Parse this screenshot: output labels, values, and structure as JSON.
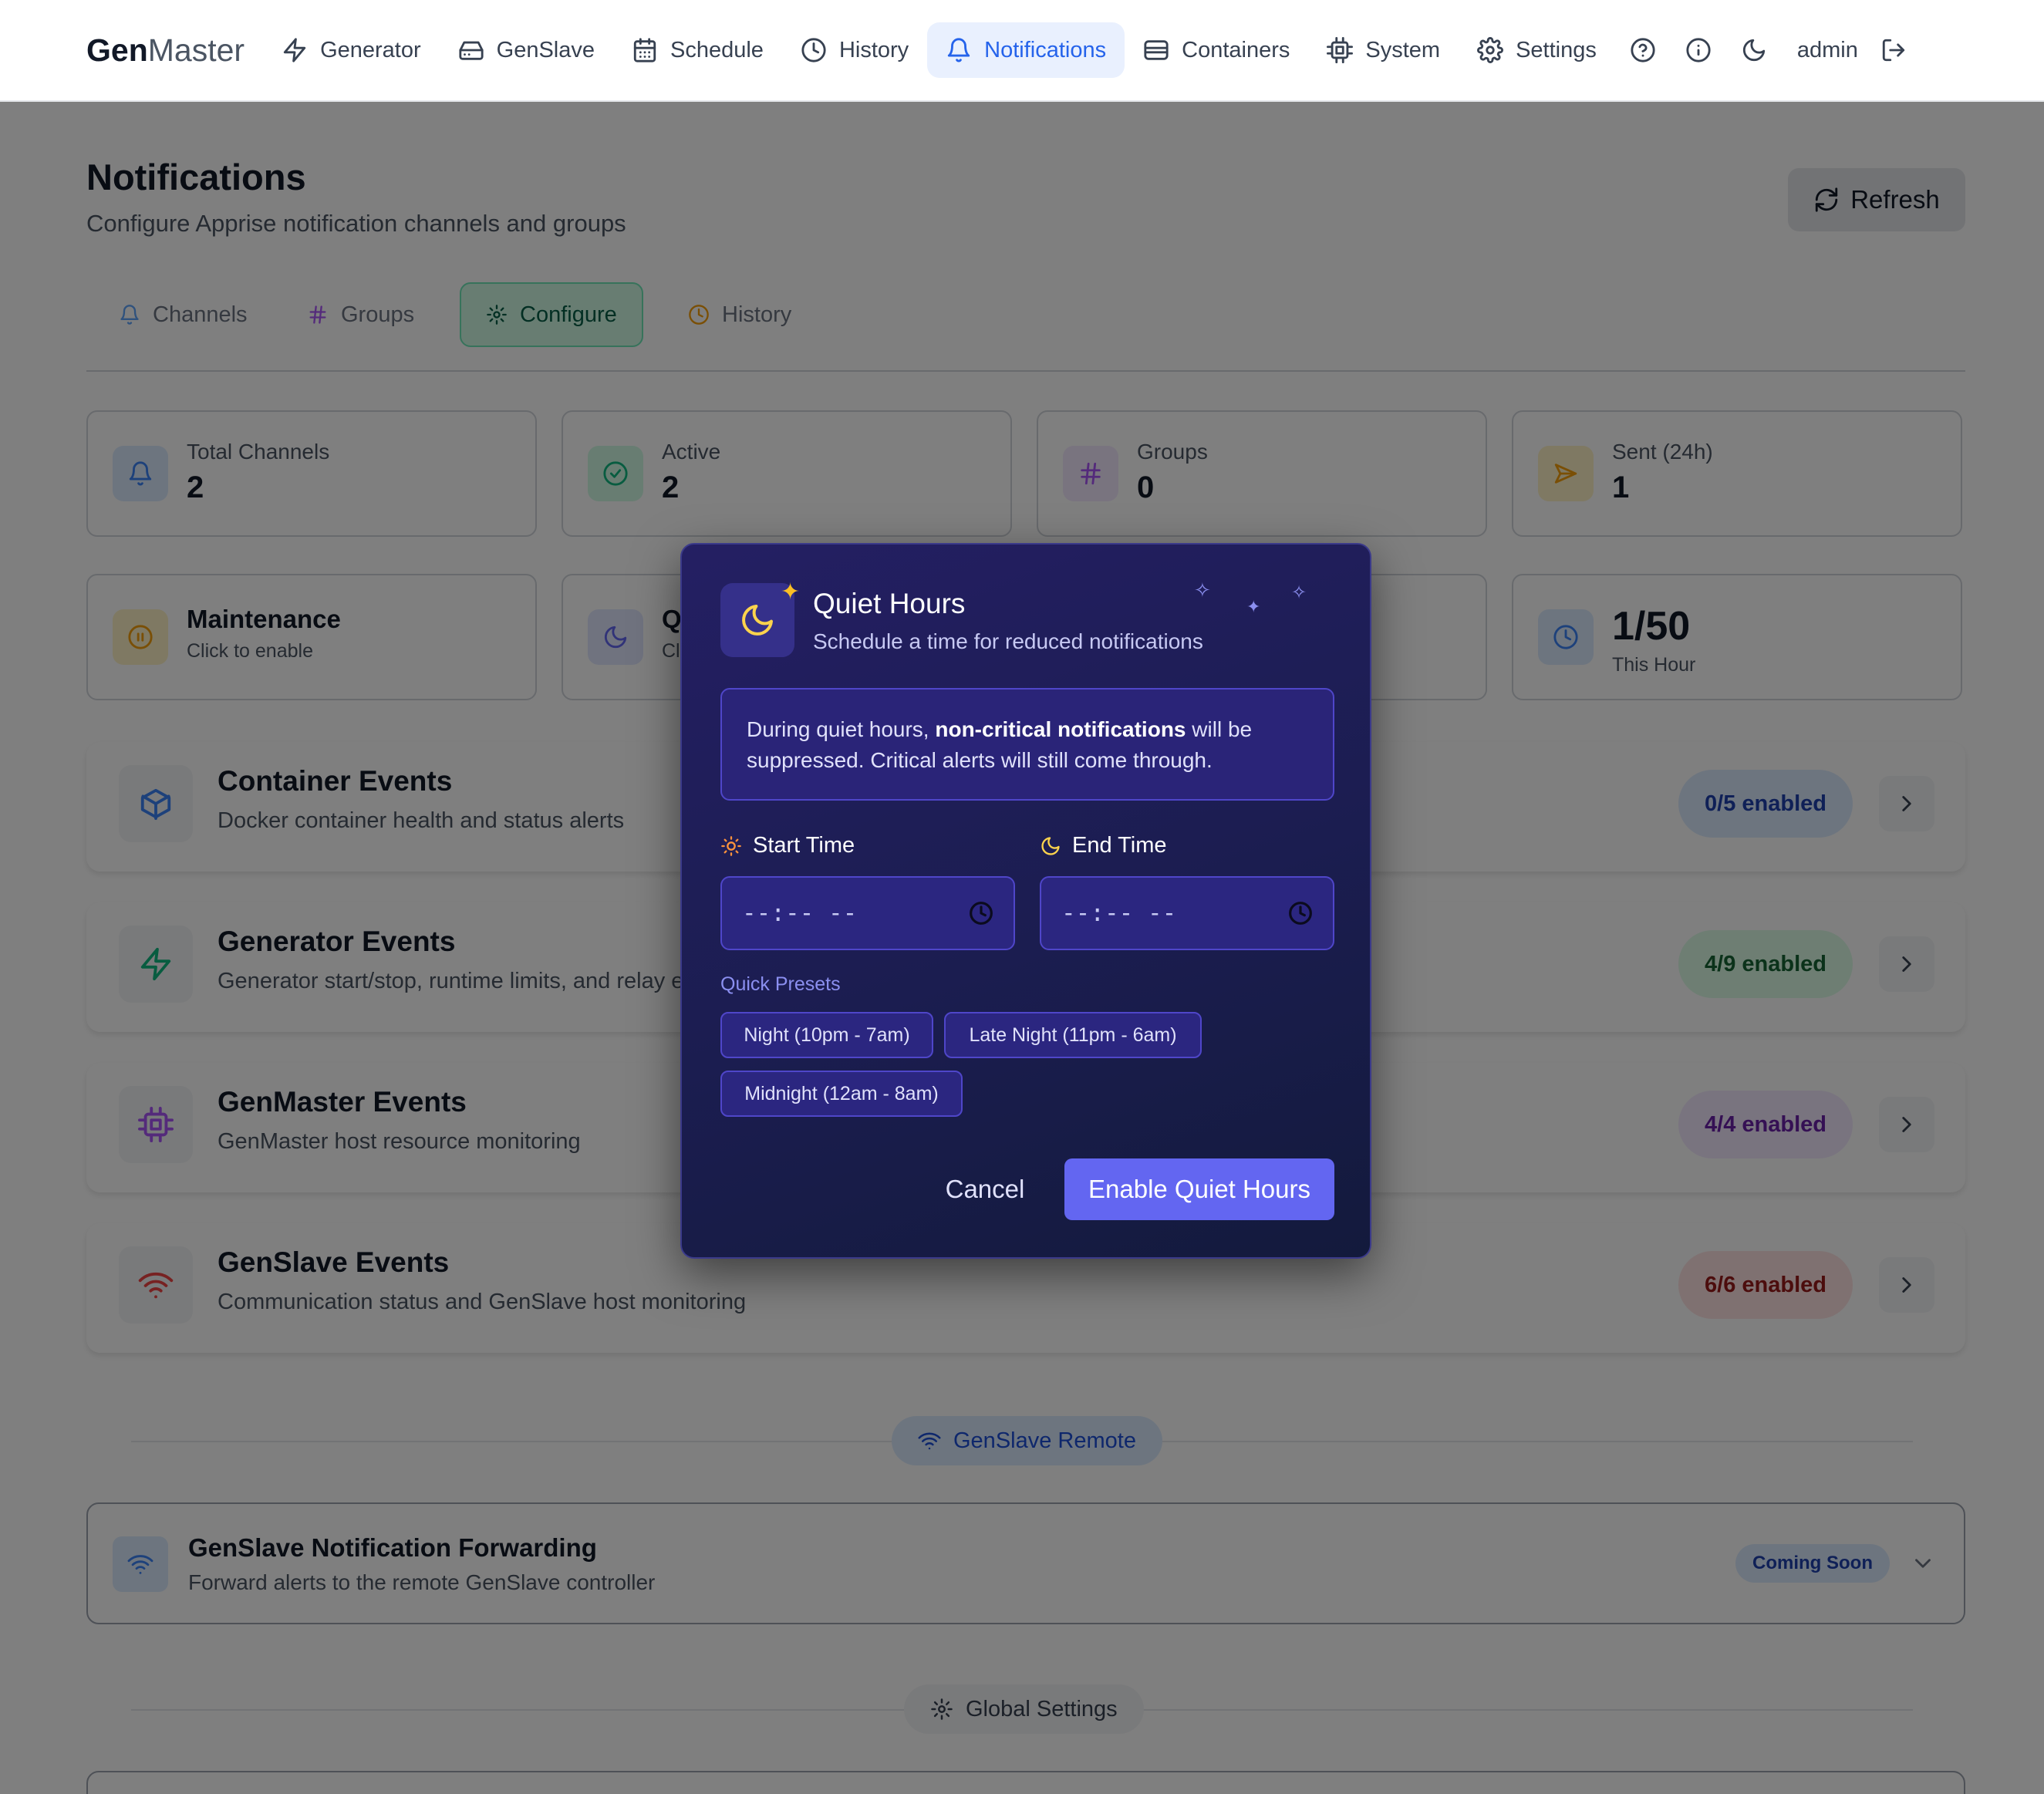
{
  "nav": {
    "brand_bold": "Gen",
    "brand_light": "Master",
    "items": [
      {
        "label": "Generator",
        "icon": "zap-icon"
      },
      {
        "label": "GenSlave",
        "icon": "hard-drive-icon"
      },
      {
        "label": "Schedule",
        "icon": "calendar-icon"
      },
      {
        "label": "History",
        "icon": "clock-icon"
      },
      {
        "label": "Notifications",
        "icon": "bell-icon",
        "active": true
      },
      {
        "label": "Containers",
        "icon": "containers-icon"
      },
      {
        "label": "System",
        "icon": "cpu-icon"
      },
      {
        "label": "Settings",
        "icon": "gear-icon"
      }
    ],
    "user": "admin"
  },
  "page": {
    "title": "Notifications",
    "subtitle": "Configure Apprise notification channels and groups",
    "refresh_label": "Refresh"
  },
  "tabs": [
    {
      "label": "Channels",
      "icon": "bell-icon"
    },
    {
      "label": "Groups",
      "icon": "hash-icon"
    },
    {
      "label": "Configure",
      "icon": "gear-icon",
      "selected": true
    },
    {
      "label": "History",
      "icon": "clock-icon"
    }
  ],
  "stats": {
    "total_channels": {
      "label": "Total Channels",
      "value": "2"
    },
    "active": {
      "label": "Active",
      "value": "2"
    },
    "groups": {
      "label": "Groups",
      "value": "0"
    },
    "sent": {
      "label": "Sent (24h)",
      "value": "1"
    },
    "maintenance": {
      "title": "Maintenance",
      "sub": "Click to enable"
    },
    "quiet_partial": {
      "title": "Q",
      "sub": "Cl"
    },
    "rate": {
      "value": "1/50",
      "sub": "This Hour"
    }
  },
  "events": [
    {
      "title": "Container Events",
      "desc": "Docker container health and status alerts",
      "badge": "0/5 enabled"
    },
    {
      "title": "Generator Events",
      "desc": "Generator start/stop, runtime limits, and relay e",
      "badge": "4/9 enabled"
    },
    {
      "title": "GenMaster Events",
      "desc": "GenMaster host resource monitoring",
      "badge": "4/4 enabled"
    },
    {
      "title": "GenSlave Events",
      "desc": "Communication status and GenSlave host monitoring",
      "badge": "6/6 enabled"
    }
  ],
  "genslave_remote": {
    "pill": "GenSlave Remote",
    "forward_title": "GenSlave Notification Forwarding",
    "forward_desc": "Forward alerts to the remote GenSlave controller",
    "coming_soon": "Coming Soon"
  },
  "global_settings": {
    "pill": "Global Settings"
  },
  "modal": {
    "title": "Quiet Hours",
    "subtitle": "Schedule a time for reduced notifications",
    "info_pre": "During quiet hours,",
    "info_bold": "non-critical notifications",
    "info_post": "will be suppressed. Critical alerts will still come through.",
    "start_label": "Start Time",
    "end_label": "End Time",
    "start_value": "--:-- --",
    "end_value": "--:-- --",
    "presets_label": "Quick Presets",
    "presets": [
      "Night (10pm - 7am)",
      "Late Night (11pm - 6am)",
      "Midnight (12am - 8am)"
    ],
    "cancel": "Cancel",
    "enable": "Enable Quiet Hours"
  },
  "colors": {
    "accent_blue": "#2563eb",
    "configure_green": "#065f46",
    "modal_bg": "#1b1d50",
    "enable_button": "#6366f1",
    "badge_blue": "#1e40af",
    "badge_green": "#166534",
    "badge_purple": "#6b21a8",
    "badge_red": "#991b1b"
  }
}
